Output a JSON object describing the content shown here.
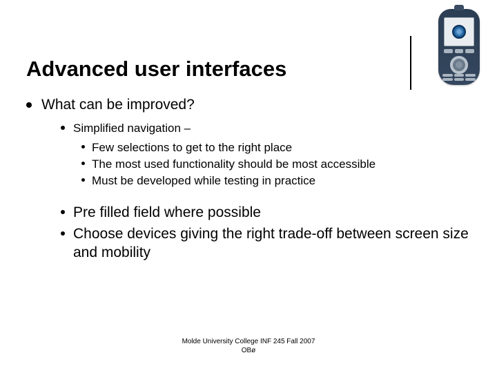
{
  "title": "Advanced user interfaces",
  "main": {
    "heading": "What can be improved?",
    "simplified_nav": {
      "label": "Simplified navigation –",
      "items": [
        "Few selections to get to the right place",
        "The most used functionality should be most accessible",
        "Must be developed while testing in practice"
      ]
    },
    "more": [
      "Pre filled field where possible",
      "Choose devices giving the right trade-off between screen size and mobility"
    ]
  },
  "footer": {
    "line1": "Molde University College INF 245 Fall 2007",
    "line2": "OBø"
  }
}
